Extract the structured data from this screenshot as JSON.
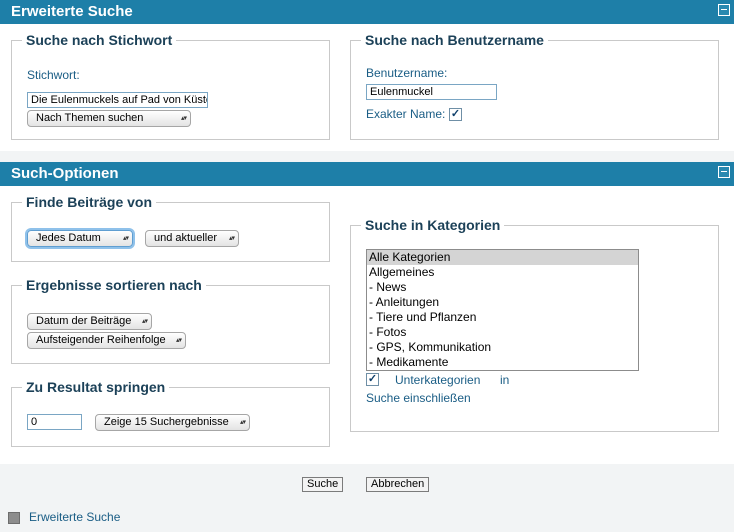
{
  "advanced": {
    "title": "Erweiterte Suche",
    "keyword_box": {
      "legend": "Suche nach Stichwort",
      "label": "Stichwort:",
      "value": "Die Eulenmuckels auf Pad von Küste",
      "scope_select": "Nach Themen suchen"
    },
    "user_box": {
      "legend": "Suche nach Benutzername",
      "label": "Benutzername:",
      "value": "Eulenmuckel",
      "exact_label": "Exakter Name:",
      "exact_checked": true
    }
  },
  "options": {
    "title": "Such-Optionen",
    "find_box": {
      "legend": "Finde Beiträge von",
      "date_select": "Jedes Datum",
      "direction_select": "und aktueller"
    },
    "sort_box": {
      "legend": "Ergebnisse sortieren nach",
      "sort_by": "Datum der Beiträge",
      "order": "Aufsteigender Reihenfolge"
    },
    "jump_box": {
      "legend": "Zu Resultat springen",
      "value": "0",
      "per_page": "Zeige 15 Suchergebnisse"
    },
    "category_box": {
      "legend": "Suche in Kategorien",
      "items": [
        "Alle Kategorien",
        "Allgemeines",
        "- News",
        "- Anleitungen",
        "- Tiere und Pflanzen",
        "- Fotos",
        "- GPS, Kommunikation",
        "- Medikamente"
      ],
      "selected": "Alle Kategorien",
      "sub_word1": "Unterkategorien",
      "sub_word2": "in",
      "sub_line2": "Suche einschließen",
      "sub_checked": true
    }
  },
  "buttons": {
    "search": "Suche",
    "cancel": "Abbrechen"
  },
  "footer": {
    "link": "Erweiterte Suche"
  },
  "icons": {
    "collapse": "collapse-icon",
    "dropdown": "dropdown-arrow-icon",
    "check": "checkmark-icon"
  },
  "colors": {
    "header": "#1e7fa8",
    "label": "#1a5d85",
    "legend": "#1c4158"
  }
}
